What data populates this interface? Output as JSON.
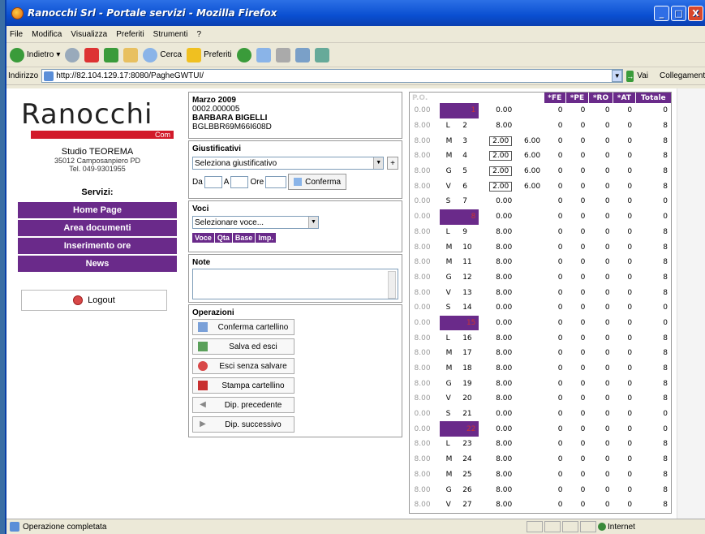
{
  "window": {
    "title": "Ranocchi Srl - Portale servizi - Mozilla Firefox",
    "controls": [
      "_",
      "□",
      "X"
    ]
  },
  "menu": [
    "File",
    "Modifica",
    "Visualizza",
    "Preferiti",
    "Strumenti",
    "?"
  ],
  "toolbar": {
    "back": "Indietro",
    "search": "Cerca",
    "favorites": "Preferiti"
  },
  "address": {
    "label": "Indirizzo",
    "url": "http://82.104.129.17:8080/PagheGWTUI/",
    "go": "Vai",
    "links": "Collegamenti"
  },
  "sidebar": {
    "logo": "Ranocchi",
    "logo_sub": "Com",
    "studio": "Studio TEOREMA",
    "street": "35012 Camposanpiero PD",
    "phone": "Tel. 049-9301955",
    "services_title": "Servizi:",
    "nav": [
      "Home Page",
      "Area documenti",
      "Inserimento ore",
      "News"
    ],
    "logout": "Logout"
  },
  "employee": {
    "month": "Marzo 2009",
    "code": "0002.000005",
    "name": "BARBARA BIGELLI",
    "cf": "BGLBBR69M66I608D"
  },
  "giustificativi": {
    "title": "Giustificativi",
    "select": "Seleziona giustificativo",
    "plus": "+",
    "da": "Da",
    "a": "A",
    "ore": "Ore",
    "confirm": "Conferma"
  },
  "voci": {
    "title": "Voci",
    "select": "Selezionare voce...",
    "tags": [
      "Voce",
      "Qta",
      "Base",
      "Imp."
    ]
  },
  "note": {
    "title": "Note"
  },
  "operazioni": {
    "title": "Operazioni",
    "buttons": [
      "Conferma cartellino",
      "Salva ed esci",
      "Esci senza salvare",
      "Stampa cartellino",
      "Dip. precedente",
      "Dip. successivo"
    ]
  },
  "grid": {
    "headers": [
      "*FE",
      "*PE",
      "*RO",
      "*AT",
      "Totale"
    ],
    "first_header": "P.O.",
    "rows": [
      {
        "h": "0.00",
        "d": "",
        "n": "1",
        "v": "0.00",
        "e": "",
        "fe": "0",
        "pe": "0",
        "ro": "0",
        "at": "0",
        "tot": "0",
        "hol": true
      },
      {
        "h": "8.00",
        "d": "L",
        "n": "2",
        "v": "8.00",
        "e": "",
        "fe": "0",
        "pe": "0",
        "ro": "0",
        "at": "0",
        "tot": "8"
      },
      {
        "h": "8.00",
        "d": "M",
        "n": "3",
        "v": "2.00",
        "e": "6.00",
        "fe": "0",
        "pe": "0",
        "ro": "0",
        "at": "0",
        "tot": "8",
        "box": true
      },
      {
        "h": "8.00",
        "d": "M",
        "n": "4",
        "v": "2.00",
        "e": "6.00",
        "fe": "0",
        "pe": "0",
        "ro": "0",
        "at": "0",
        "tot": "8",
        "box": true
      },
      {
        "h": "8.00",
        "d": "G",
        "n": "5",
        "v": "2.00",
        "e": "6.00",
        "fe": "0",
        "pe": "0",
        "ro": "0",
        "at": "0",
        "tot": "8",
        "box": true
      },
      {
        "h": "8.00",
        "d": "V",
        "n": "6",
        "v": "2.00",
        "e": "6.00",
        "fe": "0",
        "pe": "0",
        "ro": "0",
        "at": "0",
        "tot": "8",
        "box": true
      },
      {
        "h": "0.00",
        "d": "S",
        "n": "7",
        "v": "0.00",
        "e": "",
        "fe": "0",
        "pe": "0",
        "ro": "0",
        "at": "0",
        "tot": "0"
      },
      {
        "h": "0.00",
        "d": "",
        "n": "8",
        "v": "0.00",
        "e": "",
        "fe": "0",
        "pe": "0",
        "ro": "0",
        "at": "0",
        "tot": "0",
        "hol": true
      },
      {
        "h": "8.00",
        "d": "L",
        "n": "9",
        "v": "8.00",
        "e": "",
        "fe": "0",
        "pe": "0",
        "ro": "0",
        "at": "0",
        "tot": "8"
      },
      {
        "h": "8.00",
        "d": "M",
        "n": "10",
        "v": "8.00",
        "e": "",
        "fe": "0",
        "pe": "0",
        "ro": "0",
        "at": "0",
        "tot": "8"
      },
      {
        "h": "8.00",
        "d": "M",
        "n": "11",
        "v": "8.00",
        "e": "",
        "fe": "0",
        "pe": "0",
        "ro": "0",
        "at": "0",
        "tot": "8"
      },
      {
        "h": "8.00",
        "d": "G",
        "n": "12",
        "v": "8.00",
        "e": "",
        "fe": "0",
        "pe": "0",
        "ro": "0",
        "at": "0",
        "tot": "8"
      },
      {
        "h": "8.00",
        "d": "V",
        "n": "13",
        "v": "8.00",
        "e": "",
        "fe": "0",
        "pe": "0",
        "ro": "0",
        "at": "0",
        "tot": "8"
      },
      {
        "h": "0.00",
        "d": "S",
        "n": "14",
        "v": "0.00",
        "e": "",
        "fe": "0",
        "pe": "0",
        "ro": "0",
        "at": "0",
        "tot": "0"
      },
      {
        "h": "0.00",
        "d": "",
        "n": "15",
        "v": "0.00",
        "e": "",
        "fe": "0",
        "pe": "0",
        "ro": "0",
        "at": "0",
        "tot": "0",
        "hol": true
      },
      {
        "h": "8.00",
        "d": "L",
        "n": "16",
        "v": "8.00",
        "e": "",
        "fe": "0",
        "pe": "0",
        "ro": "0",
        "at": "0",
        "tot": "8"
      },
      {
        "h": "8.00",
        "d": "M",
        "n": "17",
        "v": "8.00",
        "e": "",
        "fe": "0",
        "pe": "0",
        "ro": "0",
        "at": "0",
        "tot": "8"
      },
      {
        "h": "8.00",
        "d": "M",
        "n": "18",
        "v": "8.00",
        "e": "",
        "fe": "0",
        "pe": "0",
        "ro": "0",
        "at": "0",
        "tot": "8"
      },
      {
        "h": "8.00",
        "d": "G",
        "n": "19",
        "v": "8.00",
        "e": "",
        "fe": "0",
        "pe": "0",
        "ro": "0",
        "at": "0",
        "tot": "8"
      },
      {
        "h": "8.00",
        "d": "V",
        "n": "20",
        "v": "8.00",
        "e": "",
        "fe": "0",
        "pe": "0",
        "ro": "0",
        "at": "0",
        "tot": "8"
      },
      {
        "h": "0.00",
        "d": "S",
        "n": "21",
        "v": "0.00",
        "e": "",
        "fe": "0",
        "pe": "0",
        "ro": "0",
        "at": "0",
        "tot": "0"
      },
      {
        "h": "0.00",
        "d": "",
        "n": "22",
        "v": "0.00",
        "e": "",
        "fe": "0",
        "pe": "0",
        "ro": "0",
        "at": "0",
        "tot": "0",
        "hol": true
      },
      {
        "h": "8.00",
        "d": "L",
        "n": "23",
        "v": "8.00",
        "e": "",
        "fe": "0",
        "pe": "0",
        "ro": "0",
        "at": "0",
        "tot": "8"
      },
      {
        "h": "8.00",
        "d": "M",
        "n": "24",
        "v": "8.00",
        "e": "",
        "fe": "0",
        "pe": "0",
        "ro": "0",
        "at": "0",
        "tot": "8"
      },
      {
        "h": "8.00",
        "d": "M",
        "n": "25",
        "v": "8.00",
        "e": "",
        "fe": "0",
        "pe": "0",
        "ro": "0",
        "at": "0",
        "tot": "8"
      },
      {
        "h": "8.00",
        "d": "G",
        "n": "26",
        "v": "8.00",
        "e": "",
        "fe": "0",
        "pe": "0",
        "ro": "0",
        "at": "0",
        "tot": "8"
      },
      {
        "h": "8.00",
        "d": "V",
        "n": "27",
        "v": "8.00",
        "e": "",
        "fe": "0",
        "pe": "0",
        "ro": "0",
        "at": "0",
        "tot": "8"
      }
    ]
  },
  "status": {
    "text": "Operazione completata",
    "zone": "Internet"
  },
  "colors": {
    "accent": "#6a2a8a",
    "logo_red": "#d21a2a"
  }
}
